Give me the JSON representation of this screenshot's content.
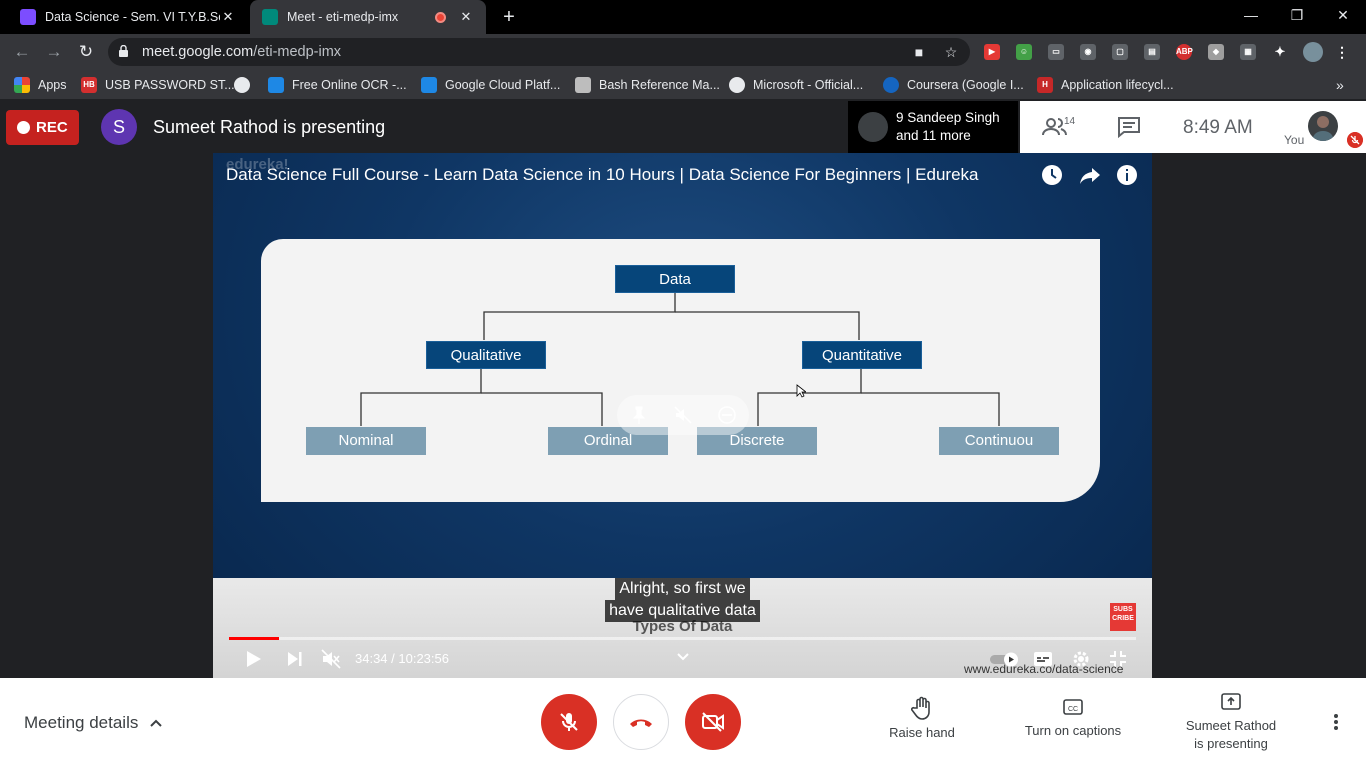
{
  "browser": {
    "tabs": [
      {
        "title": "Data Science - Sem. VI T.Y.B.Sc. (C",
        "favicon_color": "#7c4dff"
      },
      {
        "title": "Meet - eti-medp-imx",
        "favicon_color": "#00897b",
        "recording": true
      }
    ],
    "url_domain": "meet.google.com",
    "url_path": "/eti-medp-imx",
    "bookmarks": [
      {
        "label": "Apps",
        "icon": "apps-grid-icon"
      },
      {
        "label": "USB PASSWORD ST...",
        "icon_text": "HB",
        "color": "#d32f2f"
      },
      {
        "label": "",
        "icon": "globe-icon"
      },
      {
        "label": "Free Online OCR -...",
        "icon": "grid-icon",
        "color": "#1e88e5"
      },
      {
        "label": "Google Cloud Platf...",
        "icon": "chip-icon",
        "color": "#1e88e5"
      },
      {
        "label": "Bash Reference Ma...",
        "icon": "gnu-icon"
      },
      {
        "label": "Microsoft - Official...",
        "icon": "globe-icon"
      },
      {
        "label": "Coursera (Google I...",
        "icon": "coursera-icon",
        "color": "#1565c0"
      },
      {
        "label": "Application lifecycl...",
        "icon_text": "H",
        "color": "#c62828"
      }
    ],
    "extensions": [
      "ABP"
    ]
  },
  "meet": {
    "rec_label": "REC",
    "presenter_initial": "S",
    "presenter_title": "Sumeet Rathod is presenting",
    "participants_line1": "9 Sandeep Singh",
    "participants_line2": "and 11 more",
    "people_count": "14",
    "time": "8:49  AM",
    "you_label": "You"
  },
  "video": {
    "watermark": "edureka!",
    "title": "Data Science Full Course - Learn Data Science in 10 Hours | Data Science For Beginners | Edureka",
    "diagram": {
      "root": "Data",
      "qualitative": "Qualitative",
      "quantitative": "Quantitative",
      "nominal": "Nominal",
      "ordinal": "Ordinal",
      "discrete": "Discrete",
      "continuous": "Continuou"
    },
    "caption_line1": "Alright, so first we",
    "caption_line2": "have qualitative data",
    "slide_subtitle": "Types Of Data",
    "subscribe_label": "SUBS CRIBE",
    "time_display": "34:34 / 10:23:56",
    "progress_fraction": 0.0553,
    "site_url": "www.edureka.co/data-science"
  },
  "bottom": {
    "meeting_details": "Meeting details",
    "raise_hand": "Raise hand",
    "captions": "Turn on captions",
    "presenting_line1": "Sumeet Rathod",
    "presenting_line2": "is presenting"
  },
  "colors": {
    "rec_red": "#c5221f",
    "control_red": "#d93025",
    "diagram_primary": "#06457a",
    "diagram_leaf": "#7e9fb3"
  }
}
